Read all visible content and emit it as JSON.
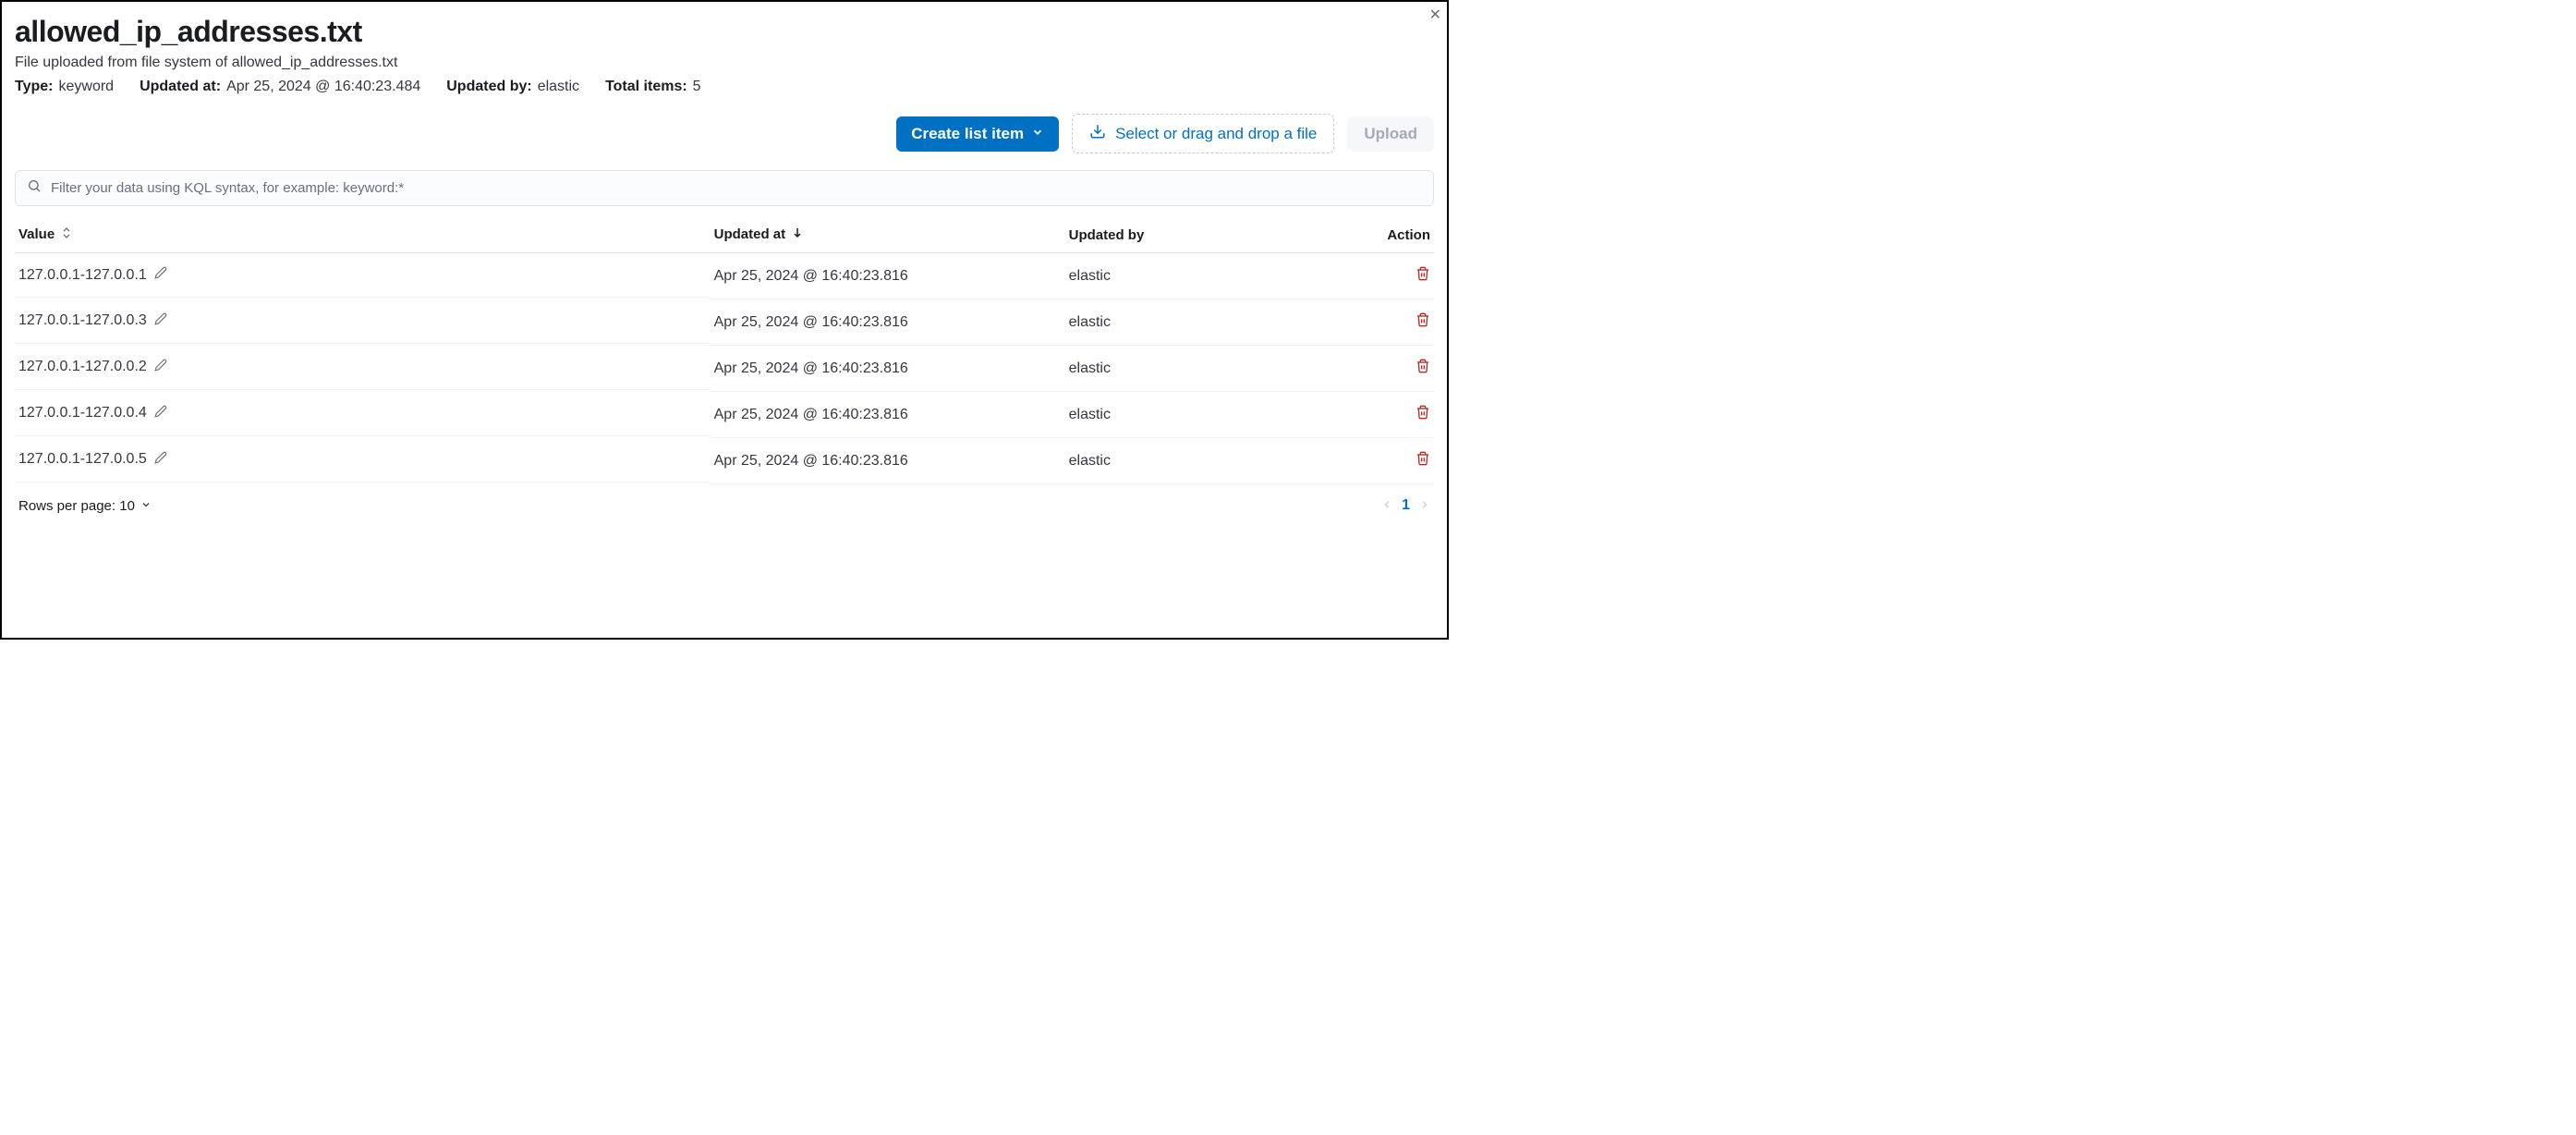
{
  "header": {
    "title": "allowed_ip_addresses.txt",
    "subtitle": "File uploaded from file system of allowed_ip_addresses.txt",
    "meta": {
      "type_label": "Type:",
      "type_value": "keyword",
      "updated_at_label": "Updated at:",
      "updated_at_value": "Apr 25, 2024 @ 16:40:23.484",
      "updated_by_label": "Updated by:",
      "updated_by_value": "elastic",
      "total_items_label": "Total items:",
      "total_items_value": "5"
    }
  },
  "actions": {
    "create_label": "Create list item",
    "file_drop_label": "Select or drag and drop a file",
    "upload_label": "Upload"
  },
  "search": {
    "placeholder": "Filter your data using KQL syntax, for example: keyword:*"
  },
  "table": {
    "columns": {
      "value": "Value",
      "updated_at": "Updated at",
      "updated_by": "Updated by",
      "action": "Action"
    },
    "rows": [
      {
        "value": "127.0.0.1-127.0.0.1",
        "updated_at": "Apr 25, 2024 @ 16:40:23.816",
        "updated_by": "elastic"
      },
      {
        "value": "127.0.0.1-127.0.0.3",
        "updated_at": "Apr 25, 2024 @ 16:40:23.816",
        "updated_by": "elastic"
      },
      {
        "value": "127.0.0.1-127.0.0.2",
        "updated_at": "Apr 25, 2024 @ 16:40:23.816",
        "updated_by": "elastic"
      },
      {
        "value": "127.0.0.1-127.0.0.4",
        "updated_at": "Apr 25, 2024 @ 16:40:23.816",
        "updated_by": "elastic"
      },
      {
        "value": "127.0.0.1-127.0.0.5",
        "updated_at": "Apr 25, 2024 @ 16:40:23.816",
        "updated_by": "elastic"
      }
    ]
  },
  "footer": {
    "rows_per_page_label": "Rows per page: 10",
    "current_page": "1"
  }
}
